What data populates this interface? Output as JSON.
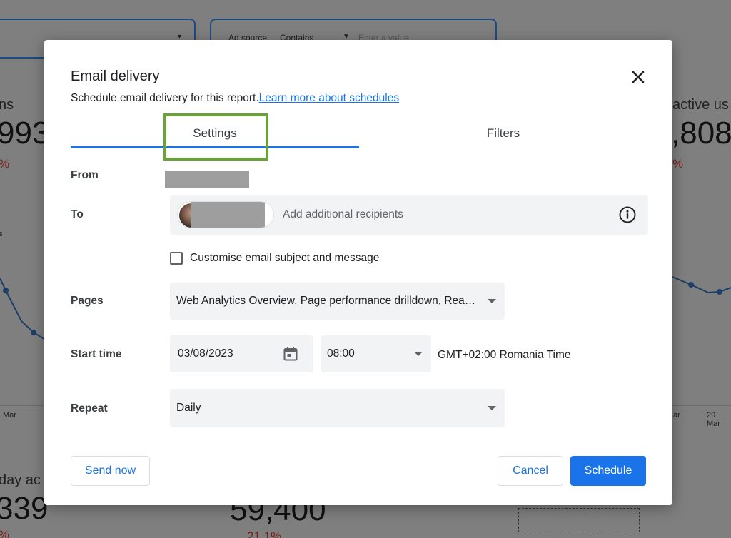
{
  "background": {
    "filter1": {
      "caret": "▾"
    },
    "filter2": {
      "label": "Ad source",
      "operator": "Contains",
      "placeholder": "Enter a value"
    },
    "left_metric": {
      "label": "ns",
      "value": "993",
      "change": "%"
    },
    "right_metric": {
      "label": "active us",
      "value": ",808",
      "change": "%"
    },
    "bottom_left": {
      "label": "day ac",
      "value": "339",
      "change": "%"
    },
    "bottom_center": {
      "value": "59,400",
      "change": "21.1%"
    },
    "left_chart": {
      "y_tick": "s",
      "x_tick": "Mar"
    },
    "right_chart": {
      "x_tick_1": "ar",
      "x_tick_2": "29 Mar"
    }
  },
  "dialog": {
    "title": "Email delivery",
    "subtitle": "Schedule email delivery for this report.",
    "learn_more": "Learn more about schedules",
    "tabs": [
      {
        "label": "Settings",
        "active": true
      },
      {
        "label": "Filters",
        "active": false
      }
    ],
    "from_label": "From",
    "to_label": "To",
    "to_placeholder": "Add additional recipients",
    "customise_label": "Customise email subject and message",
    "customise_checked": false,
    "pages_label": "Pages",
    "pages_value": "Web Analytics Overview, Page performance drilldown, Rea…",
    "start_time_label": "Start time",
    "start_date": "03/08/2023",
    "start_time": "08:00",
    "timezone": "GMT+02:00 Romania Time",
    "repeat_label": "Repeat",
    "repeat_value": "Daily",
    "send_now_label": "Send now",
    "cancel_label": "Cancel",
    "schedule_label": "Schedule"
  },
  "colors": {
    "accent": "#1a73e8",
    "highlight_box": "#6aa13a",
    "overlay": "#7f7f7f"
  },
  "icons": [
    "close-icon",
    "info-icon",
    "calendar-icon",
    "chevron-down-icon",
    "checkbox-icon"
  ]
}
